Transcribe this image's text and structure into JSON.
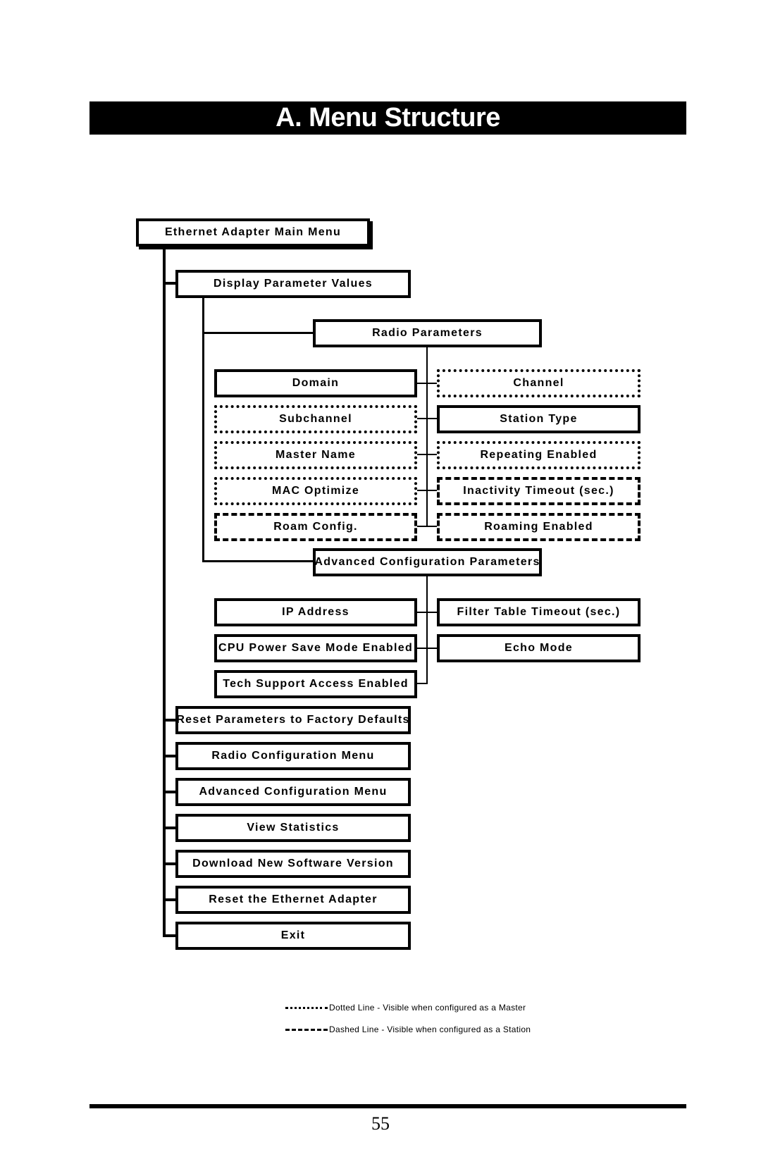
{
  "page": {
    "title": "A. Menu Structure",
    "page_number": "55"
  },
  "diagram": {
    "root": {
      "label": "Ethernet Adapter Main Menu",
      "style": "solid"
    },
    "main_menu": [
      {
        "label": "Display Parameter Values",
        "style": "solid"
      },
      {
        "label": "Reset Parameters to Factory Defaults",
        "style": "solid"
      },
      {
        "label": "Radio Configuration Menu",
        "style": "solid"
      },
      {
        "label": "Advanced Configuration Menu",
        "style": "solid"
      },
      {
        "label": "View Statistics",
        "style": "solid"
      },
      {
        "label": "Download New Software Version",
        "style": "solid"
      },
      {
        "label": "Reset the Ethernet Adapter",
        "style": "solid"
      },
      {
        "label": "Exit",
        "style": "solid"
      }
    ],
    "radio_parameters": {
      "label": "Radio Parameters",
      "style": "solid",
      "left": [
        {
          "label": "Domain",
          "style": "solid"
        },
        {
          "label": "Subchannel",
          "style": "dotted"
        },
        {
          "label": "Master Name",
          "style": "dotted"
        },
        {
          "label": "MAC Optimize",
          "style": "dotted"
        },
        {
          "label": "Roam Config.",
          "style": "dashed"
        }
      ],
      "right": [
        {
          "label": "Channel",
          "style": "dotted"
        },
        {
          "label": "Station Type",
          "style": "solid"
        },
        {
          "label": "Repeating Enabled",
          "style": "dotted"
        },
        {
          "label": "Inactivity Timeout (sec.)",
          "style": "dashed"
        },
        {
          "label": "Roaming Enabled",
          "style": "dashed"
        }
      ]
    },
    "advanced_parameters": {
      "label": "Advanced Configuration Parameters",
      "style": "solid",
      "left": [
        {
          "label": "IP Address",
          "style": "solid"
        },
        {
          "label": "CPU Power Save Mode Enabled",
          "style": "solid"
        },
        {
          "label": "Tech Support Access Enabled",
          "style": "solid"
        }
      ],
      "right": [
        {
          "label": "Filter Table Timeout (sec.)",
          "style": "solid"
        },
        {
          "label": "Echo Mode",
          "style": "solid"
        }
      ]
    }
  },
  "legend": [
    {
      "style": "dotted",
      "label": "Dotted Line - Visible when configured as a Master"
    },
    {
      "style": "dashed",
      "label": "Dashed Line - Visible when configured as a Station"
    }
  ]
}
